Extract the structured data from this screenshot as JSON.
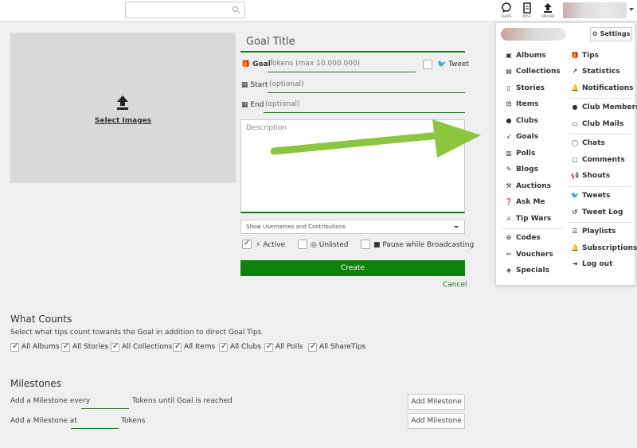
{
  "topbar": {
    "icons": [
      {
        "name": "chats",
        "label": "CHATS"
      },
      {
        "name": "post",
        "label": "POST"
      },
      {
        "name": "upload",
        "label": "UPLOAD"
      }
    ]
  },
  "image_box": {
    "select_label": "Select Images"
  },
  "form": {
    "title_placeholder": "Goal Title",
    "goal_label": "Goal",
    "goal_placeholder": "Tokens (max 10.000.000)",
    "tweet_label": "Tweet",
    "start_label": "Start",
    "start_placeholder": "(optional)",
    "end_label": "End",
    "end_placeholder": "(optional)",
    "description_placeholder": "Description",
    "visibility_select": "Show Usernames and Contributions",
    "active_label": "Active",
    "active_checked": true,
    "unlisted_label": "Unlisted",
    "pause_label": "Pause while Broadcasting",
    "create_label": "Create",
    "cancel_label": "Cancel"
  },
  "what_counts": {
    "title": "What Counts",
    "description": "Select what tips count towards the Goal in addition to direct Goal Tips",
    "options": [
      {
        "label": "All Albums",
        "checked": true
      },
      {
        "label": "All Stories",
        "checked": true
      },
      {
        "label": "All Collections",
        "checked": true
      },
      {
        "label": "All Items",
        "checked": true
      },
      {
        "label": "All Clubs",
        "checked": true
      },
      {
        "label": "All Polls",
        "checked": true
      },
      {
        "label": "All ShareTips",
        "checked": true
      }
    ]
  },
  "milestones": {
    "title": "Milestones",
    "row1_prefix": "Add a Milestone every",
    "row1_suffix": "Tokens until Goal is reached",
    "row2_prefix": "Add a Milestone at",
    "row2_suffix": "Tokens",
    "add_label": "Add Milestone"
  },
  "menu": {
    "settings_label": "Settings",
    "left_items": [
      {
        "label": "Albums",
        "icon": "album-icon"
      },
      {
        "label": "Collections",
        "icon": "collection-icon"
      },
      {
        "label": "Stories",
        "icon": "story-icon"
      },
      {
        "label": "Items",
        "icon": "cart-icon"
      },
      {
        "label": "Clubs",
        "icon": "users-icon"
      },
      {
        "label": "Goals",
        "icon": "rocket-icon"
      },
      {
        "label": "Polls",
        "icon": "poll-icon"
      },
      {
        "label": "Blogs",
        "icon": "pencil-icon"
      },
      {
        "label": "Auctions",
        "icon": "gavel-icon"
      },
      {
        "label": "Ask Me",
        "icon": "question-icon"
      },
      {
        "label": "Tip Wars",
        "icon": "swords-icon"
      },
      {
        "label": "Codes",
        "icon": "code-icon"
      },
      {
        "label": "Vouchers",
        "icon": "voucher-icon"
      },
      {
        "label": "Specials",
        "icon": "tag-icon"
      }
    ],
    "right_items": [
      {
        "label": "Tips",
        "icon": "gift-icon"
      },
      {
        "label": "Statistics",
        "icon": "chart-icon"
      },
      {
        "label": "Notifications",
        "icon": "bell-icon"
      },
      {
        "label": "Club Members",
        "icon": "members-icon"
      },
      {
        "label": "Club Mails",
        "icon": "mail-icon"
      },
      {
        "label": "Chats",
        "icon": "chat-icon"
      },
      {
        "label": "Comments",
        "icon": "comment-icon"
      },
      {
        "label": "Shouts",
        "icon": "megaphone-icon"
      },
      {
        "label": "Tweets",
        "icon": "twitter-icon"
      },
      {
        "label": "Tweet Log",
        "icon": "history-icon"
      },
      {
        "label": "Playlists",
        "icon": "playlist-icon"
      },
      {
        "label": "Subscriptions",
        "icon": "subscription-icon"
      },
      {
        "label": "Log out",
        "icon": "logout-icon"
      }
    ]
  },
  "colors": {
    "accent": "#0d820d",
    "highlight_arrow": "#8cc63f"
  }
}
